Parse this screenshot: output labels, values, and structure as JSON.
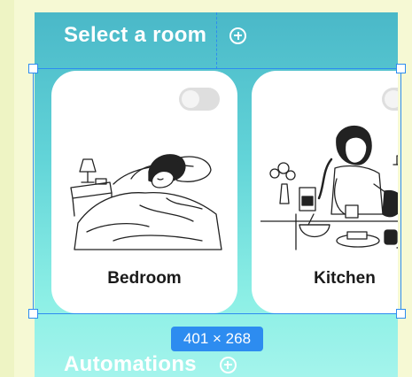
{
  "sections": {
    "rooms_title": "Select a room",
    "automations_title": "Automations"
  },
  "cards": [
    {
      "label": "Bedroom",
      "toggle_on": false,
      "illustration": "person-sleeping-in-bed"
    },
    {
      "label": "Kitchen",
      "toggle_on": false,
      "illustration": "person-pouring-coffee"
    }
  ],
  "selection": {
    "dimensions": "401 × 268"
  },
  "colors": {
    "gradient_top": "#4ab8c8",
    "gradient_bottom": "#a4f4ec",
    "selection_accent": "#2d8cf0",
    "canvas_bg": "#f6f9d4"
  },
  "icons": [
    "plus-circle-icon",
    "toggle-switch-icon"
  ]
}
